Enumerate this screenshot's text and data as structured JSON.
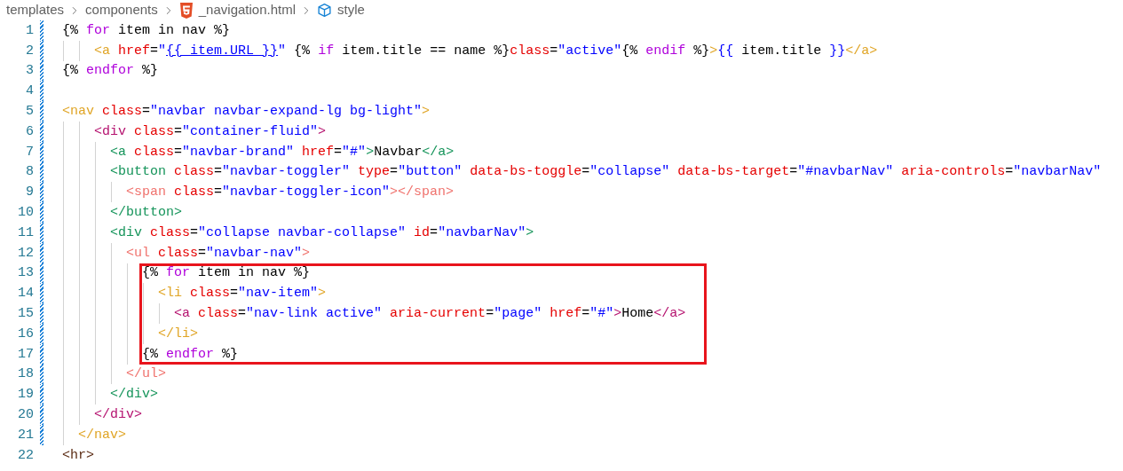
{
  "breadcrumb": [
    {
      "kind": "folder",
      "label": "templates"
    },
    {
      "kind": "folder",
      "label": "components"
    },
    {
      "kind": "html-file",
      "label": "_navigation.html"
    },
    {
      "kind": "symbol",
      "label": "style"
    }
  ],
  "lines": [
    {
      "number": "1",
      "modified": true,
      "boxed": false,
      "tokens": [
        {
          "kind": "plain",
          "text": "{% "
        },
        {
          "kind": "keyword",
          "text": "for"
        },
        {
          "kind": "plain",
          "text": " item in nav %}"
        }
      ]
    },
    {
      "number": "2",
      "modified": true,
      "boxed": false,
      "tokens": [
        {
          "kind": "tag",
          "color": "#e0a526",
          "text": "    <a"
        },
        {
          "kind": "attr",
          "text": " href"
        },
        {
          "kind": "plain",
          "text": "="
        },
        {
          "kind": "value",
          "text": "\""
        },
        {
          "kind": "link",
          "text": "{{ item.URL }}"
        },
        {
          "kind": "value",
          "text": "\""
        },
        {
          "kind": "plain",
          "text": " {% "
        },
        {
          "kind": "keyword",
          "text": "if"
        },
        {
          "kind": "plain",
          "text": " item.title == name %}"
        },
        {
          "kind": "attr",
          "text": "class"
        },
        {
          "kind": "plain",
          "text": "="
        },
        {
          "kind": "value",
          "text": "\"active\""
        },
        {
          "kind": "plain",
          "text": "{% "
        },
        {
          "kind": "keyword",
          "text": "endif"
        },
        {
          "kind": "plain",
          "text": " %}"
        },
        {
          "kind": "tag",
          "color": "#e0a526",
          "text": ">"
        },
        {
          "kind": "value",
          "text": "{{"
        },
        {
          "kind": "plain",
          "text": " item.title "
        },
        {
          "kind": "value",
          "text": "}}"
        },
        {
          "kind": "tag",
          "color": "#e0a526",
          "text": "</a>"
        }
      ]
    },
    {
      "number": "3",
      "modified": true,
      "boxed": false,
      "tokens": [
        {
          "kind": "plain",
          "text": "{% "
        },
        {
          "kind": "keyword",
          "text": "endfor"
        },
        {
          "kind": "plain",
          "text": " %}"
        }
      ]
    },
    {
      "number": "4",
      "modified": true,
      "boxed": false
    },
    {
      "number": "5",
      "modified": true,
      "boxed": false,
      "tokens": [
        {
          "kind": "tag",
          "color": "#e0a526",
          "text": "<nav"
        },
        {
          "kind": "attr",
          "text": " class"
        },
        {
          "kind": "plain",
          "text": "="
        },
        {
          "kind": "value",
          "text": "\"navbar navbar-expand-lg bg-light\""
        },
        {
          "kind": "tag",
          "color": "#e0a526",
          "text": ">"
        }
      ]
    },
    {
      "number": "6",
      "modified": true,
      "boxed": false,
      "tokens": [
        {
          "kind": "tag",
          "color": "#b5126f",
          "text": "    <div"
        },
        {
          "kind": "attr",
          "text": " class"
        },
        {
          "kind": "plain",
          "text": "="
        },
        {
          "kind": "value",
          "text": "\"container-fluid\""
        },
        {
          "kind": "tag",
          "color": "#b5126f",
          "text": ">"
        }
      ]
    },
    {
      "number": "7",
      "modified": true,
      "boxed": false,
      "tokens": [
        {
          "kind": "tag",
          "color": "#15945a",
          "text": "      <a"
        },
        {
          "kind": "attr",
          "text": " class"
        },
        {
          "kind": "plain",
          "text": "="
        },
        {
          "kind": "value",
          "text": "\"navbar-brand\""
        },
        {
          "kind": "attr",
          "text": " href"
        },
        {
          "kind": "plain",
          "text": "="
        },
        {
          "kind": "value",
          "text": "\"#\""
        },
        {
          "kind": "tag",
          "color": "#15945a",
          "text": ">"
        },
        {
          "kind": "plain",
          "text": "Navbar"
        },
        {
          "kind": "tag",
          "color": "#15945a",
          "text": "</a>"
        }
      ]
    },
    {
      "number": "8",
      "modified": true,
      "boxed": false,
      "tokens": [
        {
          "kind": "tag",
          "color": "#15945a",
          "text": "      <button"
        },
        {
          "kind": "attr",
          "text": " class"
        },
        {
          "kind": "plain",
          "text": "="
        },
        {
          "kind": "value",
          "text": "\"navbar-toggler\""
        },
        {
          "kind": "attr",
          "text": " type"
        },
        {
          "kind": "plain",
          "text": "="
        },
        {
          "kind": "value",
          "text": "\"button\""
        },
        {
          "kind": "attr",
          "text": " data-bs-toggle"
        },
        {
          "kind": "plain",
          "text": "="
        },
        {
          "kind": "value",
          "text": "\"collapse\""
        },
        {
          "kind": "attr",
          "text": " data-bs-target"
        },
        {
          "kind": "plain",
          "text": "="
        },
        {
          "kind": "value",
          "text": "\"#navbarNav\""
        },
        {
          "kind": "attr",
          "text": " aria-controls"
        },
        {
          "kind": "plain",
          "text": "="
        },
        {
          "kind": "value",
          "text": "\"navbarNav\""
        }
      ]
    },
    {
      "number": "9",
      "modified": true,
      "boxed": false,
      "tokens": [
        {
          "kind": "tag",
          "color": "#f0736e",
          "text": "        <span"
        },
        {
          "kind": "attr",
          "text": " class"
        },
        {
          "kind": "plain",
          "text": "="
        },
        {
          "kind": "value",
          "text": "\"navbar-toggler-icon\""
        },
        {
          "kind": "tag",
          "color": "#f0736e",
          "text": "></span>"
        }
      ]
    },
    {
      "number": "10",
      "modified": true,
      "boxed": false,
      "tokens": [
        {
          "kind": "tag",
          "color": "#15945a",
          "text": "      </button>"
        }
      ]
    },
    {
      "number": "11",
      "modified": true,
      "boxed": false,
      "tokens": [
        {
          "kind": "tag",
          "color": "#15945a",
          "text": "      <div"
        },
        {
          "kind": "attr",
          "text": " class"
        },
        {
          "kind": "plain",
          "text": "="
        },
        {
          "kind": "value",
          "text": "\"collapse navbar-collapse\""
        },
        {
          "kind": "attr",
          "text": " id"
        },
        {
          "kind": "plain",
          "text": "="
        },
        {
          "kind": "value",
          "text": "\"navbarNav\""
        },
        {
          "kind": "tag",
          "color": "#15945a",
          "text": ">"
        }
      ]
    },
    {
      "number": "12",
      "modified": true,
      "boxed": false,
      "tokens": [
        {
          "kind": "tag",
          "color": "#f0736e",
          "text": "        <ul"
        },
        {
          "kind": "attr",
          "text": " class"
        },
        {
          "kind": "plain",
          "text": "="
        },
        {
          "kind": "value",
          "text": "\"navbar-nav\""
        },
        {
          "kind": "tag",
          "color": "#f0736e",
          "text": ">"
        }
      ]
    },
    {
      "number": "13",
      "modified": true,
      "boxed": true,
      "tokens": [
        {
          "kind": "plain",
          "text": "          {% "
        },
        {
          "kind": "keyword",
          "text": "for"
        },
        {
          "kind": "plain",
          "text": " item in nav %}"
        }
      ]
    },
    {
      "number": "14",
      "modified": true,
      "boxed": true,
      "tokens": [
        {
          "kind": "tag",
          "color": "#e0a526",
          "text": "            <li"
        },
        {
          "kind": "attr",
          "text": " class"
        },
        {
          "kind": "plain",
          "text": "="
        },
        {
          "kind": "value",
          "text": "\"nav-item\""
        },
        {
          "kind": "tag",
          "color": "#e0a526",
          "text": ">"
        }
      ]
    },
    {
      "number": "15",
      "modified": true,
      "boxed": true,
      "tokens": [
        {
          "kind": "tag",
          "color": "#b5126f",
          "text": "              <a"
        },
        {
          "kind": "attr",
          "text": " class"
        },
        {
          "kind": "plain",
          "text": "="
        },
        {
          "kind": "value",
          "text": "\"nav-link active\""
        },
        {
          "kind": "attr",
          "text": " aria-current"
        },
        {
          "kind": "plain",
          "text": "="
        },
        {
          "kind": "value",
          "text": "\"page\""
        },
        {
          "kind": "attr",
          "text": " href"
        },
        {
          "kind": "plain",
          "text": "="
        },
        {
          "kind": "value",
          "text": "\"#\""
        },
        {
          "kind": "tag",
          "color": "#b5126f",
          "text": ">"
        },
        {
          "kind": "plain",
          "text": "Home"
        },
        {
          "kind": "tag",
          "color": "#b5126f",
          "text": "</a>"
        }
      ]
    },
    {
      "number": "16",
      "modified": true,
      "boxed": true,
      "tokens": [
        {
          "kind": "tag",
          "color": "#e0a526",
          "text": "            </li>"
        }
      ]
    },
    {
      "number": "17",
      "modified": true,
      "boxed": true,
      "tokens": [
        {
          "kind": "plain",
          "text": "          {% "
        },
        {
          "kind": "keyword",
          "text": "endfor"
        },
        {
          "kind": "plain",
          "text": " %}"
        }
      ]
    },
    {
      "number": "18",
      "modified": true,
      "boxed": false,
      "tokens": [
        {
          "kind": "tag",
          "color": "#f0736e",
          "text": "        </ul>"
        }
      ]
    },
    {
      "number": "19",
      "modified": true,
      "boxed": false,
      "tokens": [
        {
          "kind": "tag",
          "color": "#15945a",
          "text": "      </div>"
        }
      ]
    },
    {
      "number": "20",
      "modified": true,
      "boxed": false,
      "tokens": [
        {
          "kind": "tag",
          "color": "#b5126f",
          "text": "    </div>"
        }
      ]
    },
    {
      "number": "21",
      "modified": true,
      "boxed": false,
      "tokens": [
        {
          "kind": "tag",
          "color": "#e0a526",
          "text": "  </nav>"
        }
      ]
    },
    {
      "number": "22",
      "modified": false,
      "boxed": false,
      "tokens": [
        {
          "kind": "tag",
          "color": "#5a2a12",
          "text": "<hr>"
        }
      ]
    }
  ]
}
